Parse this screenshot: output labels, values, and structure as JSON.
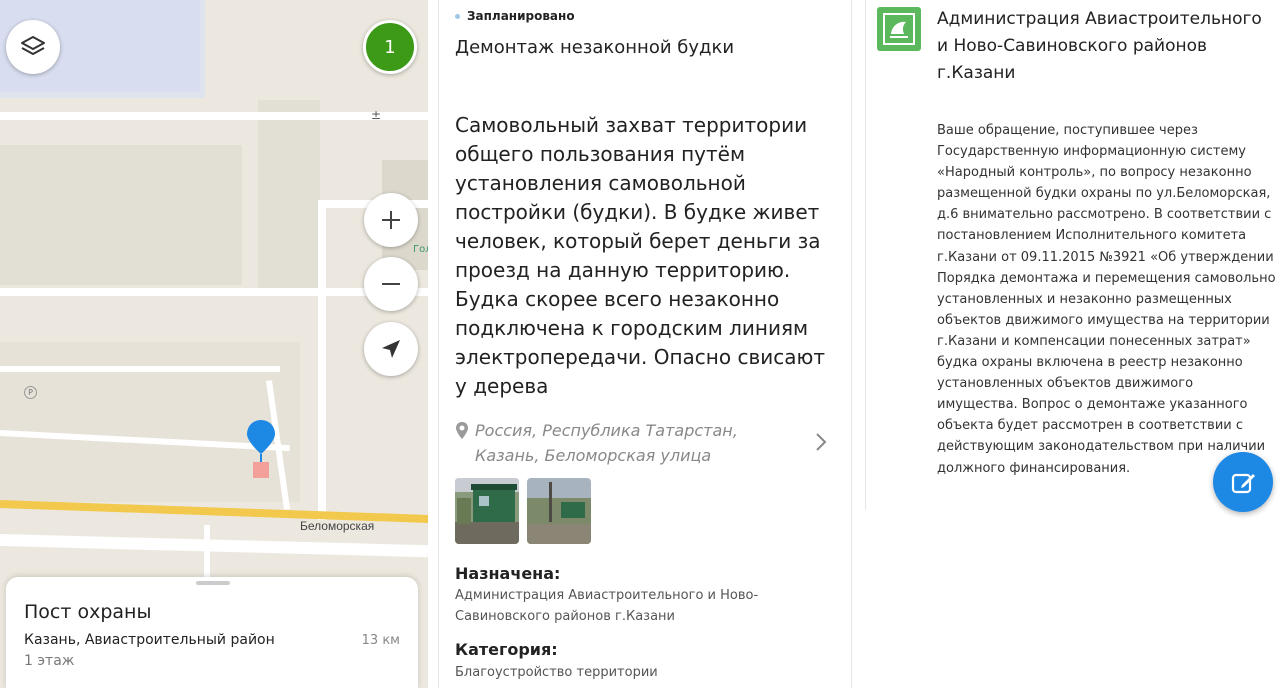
{
  "map": {
    "cluster_count": "1",
    "street_label": "Беломорская",
    "poi_label": "Гол",
    "card": {
      "title": "Пост охраны",
      "subtitle": "Казань, Авиастроительный район",
      "distance": "13 км",
      "floor": "1 этаж"
    },
    "icons": {
      "layers": "layers-icon",
      "zoom_in": "plus-icon",
      "zoom_out": "minus-icon",
      "locate": "navigation-arrow-icon",
      "pin": "map-pin-icon",
      "parking": "parking-icon"
    }
  },
  "issue": {
    "status": "Запланировано",
    "title": "Демонтаж незаконной будки",
    "description": "Самовольный захват территории общего пользования путём установления самовольной постройки (будки). В будке живет человек, который берет деньги за проезд на данную территорию. Будка скорее всего незаконно подключена к городским линиям электропередачи. Опасно свисают у дерева",
    "address": "Россия, Республика Татарстан, Казань, Беломорская улица",
    "assigned_label": "Назначена:",
    "assigned_value": "Администрация Авиастроительного и Ново-Савиновского районов г.Казани",
    "category_label": "Категория:",
    "category_value": "Благоустройство территории"
  },
  "response": {
    "org_name": "Администрация Авиастроительного и Ново-Савиновского районов г.Казани",
    "text": "Ваше обращение, поступившее через Государственную информационную систему «Народный контроль», по вопросу незаконно размещенной будки охраны по ул.Беломорская, д.6 внимательно рассмотрено. В соответствии с постановлением Исполнительного комитета г.Казани от 09.11.2015 №3921 «Об утверждении Порядка демонтажа и перемещения самовольно установленных и незаконно размещенных объектов движимого имущества на территории г.Казани и компенсации понесенных затрат» будка охраны включена в реестр незаконно установленных объектов движимого имущества. Вопрос о демонтаже указанного объекта будет рассмотрен в соответствии с действующим законодательством при наличии должного финансирования."
  },
  "colors": {
    "cluster": "#3c9a16",
    "pin": "#1e88e5",
    "fab": "#1e88e5",
    "road_main": "#f2c94c",
    "org_logo": "#5cb85c",
    "status_dot": "#9ec7e8"
  }
}
